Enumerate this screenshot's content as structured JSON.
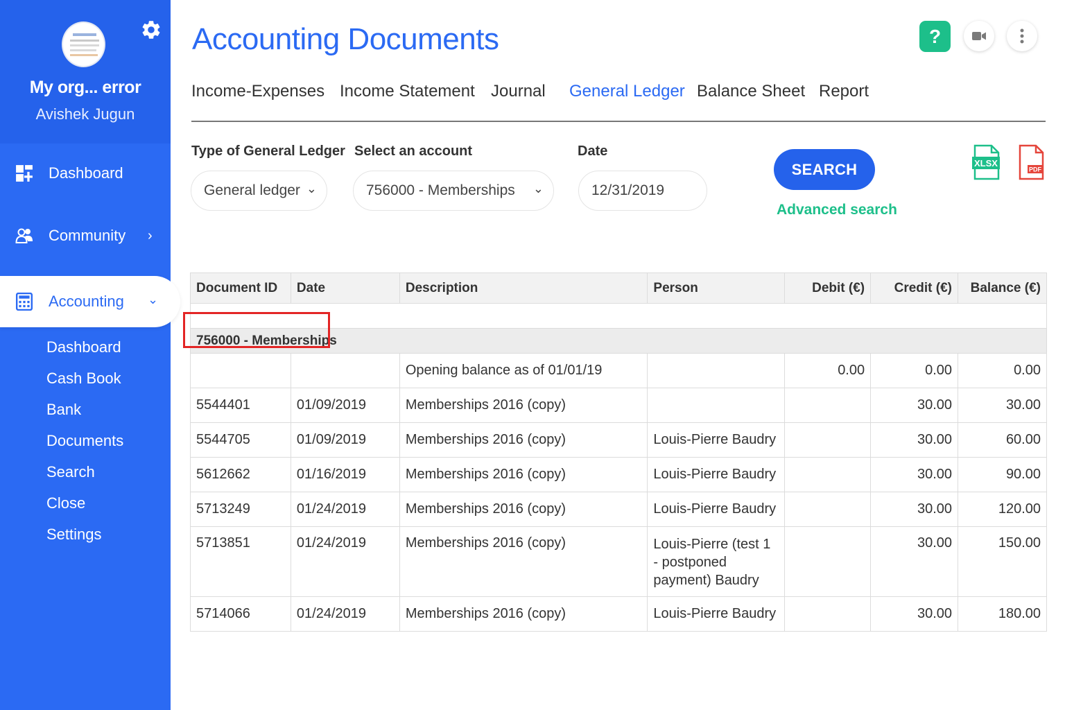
{
  "sidebar": {
    "org_name": "My org... error",
    "user_name": "Avishek Jugun",
    "nav": {
      "dashboard": "Dashboard",
      "community": "Community",
      "accounting": "Accounting"
    },
    "sub_items": [
      "Dashboard",
      "Cash Book",
      "Bank",
      "Documents",
      "Search",
      "Close",
      "Settings"
    ],
    "accent_color": "#2b6af3"
  },
  "header": {
    "title": "Accounting Documents",
    "help_label": "?"
  },
  "tabs": [
    "Income-Expenses",
    "Income Statement",
    "Journal",
    "General Ledger",
    "Balance Sheet",
    "Report"
  ],
  "active_tab": "General Ledger",
  "filters": {
    "type_label": "Type of General Ledger",
    "type_value": "General ledger",
    "account_label": "Select an account",
    "account_value": "756000 - Memberships",
    "date_label": "Date",
    "date_value": "12/31/2019",
    "search_label": "SEARCH",
    "advanced_label": "Advanced search",
    "xlsx_label": "XLSX",
    "pdf_label": "PDF"
  },
  "table": {
    "columns": [
      "Document ID",
      "Date",
      "Description",
      "Person",
      "Debit (€)",
      "Credit (€)",
      "Balance (€)"
    ],
    "group_label": "756000 - Memberships",
    "opening": {
      "description": "Opening balance as of 01/01/19",
      "debit": "0.00",
      "credit": "0.00",
      "balance": "0.00"
    },
    "rows": [
      {
        "id": "5544401",
        "date": "01/09/2019",
        "description": "Memberships 2016 (copy)",
        "person": "",
        "debit": "",
        "credit": "30.00",
        "balance": "30.00"
      },
      {
        "id": "5544705",
        "date": "01/09/2019",
        "description": "Memberships 2016 (copy)",
        "person": "Louis-Pierre Baudry",
        "debit": "",
        "credit": "30.00",
        "balance": "60.00"
      },
      {
        "id": "5612662",
        "date": "01/16/2019",
        "description": "Memberships 2016 (copy)",
        "person": "Louis-Pierre Baudry",
        "debit": "",
        "credit": "30.00",
        "balance": "90.00"
      },
      {
        "id": "5713249",
        "date": "01/24/2019",
        "description": "Memberships 2016 (copy)",
        "person": "Louis-Pierre Baudry",
        "debit": "",
        "credit": "30.00",
        "balance": "120.00"
      },
      {
        "id": "5713851",
        "date": "01/24/2019",
        "description": "Memberships 2016 (copy)",
        "person": "Louis-Pierre (test 1 - postponed payment) Baudry",
        "debit": "",
        "credit": "30.00",
        "balance": "150.00"
      },
      {
        "id": "5714066",
        "date": "01/24/2019",
        "description": "Memberships 2016 (copy)",
        "person": "Louis-Pierre Baudry",
        "debit": "",
        "credit": "30.00",
        "balance": "180.00"
      }
    ]
  }
}
